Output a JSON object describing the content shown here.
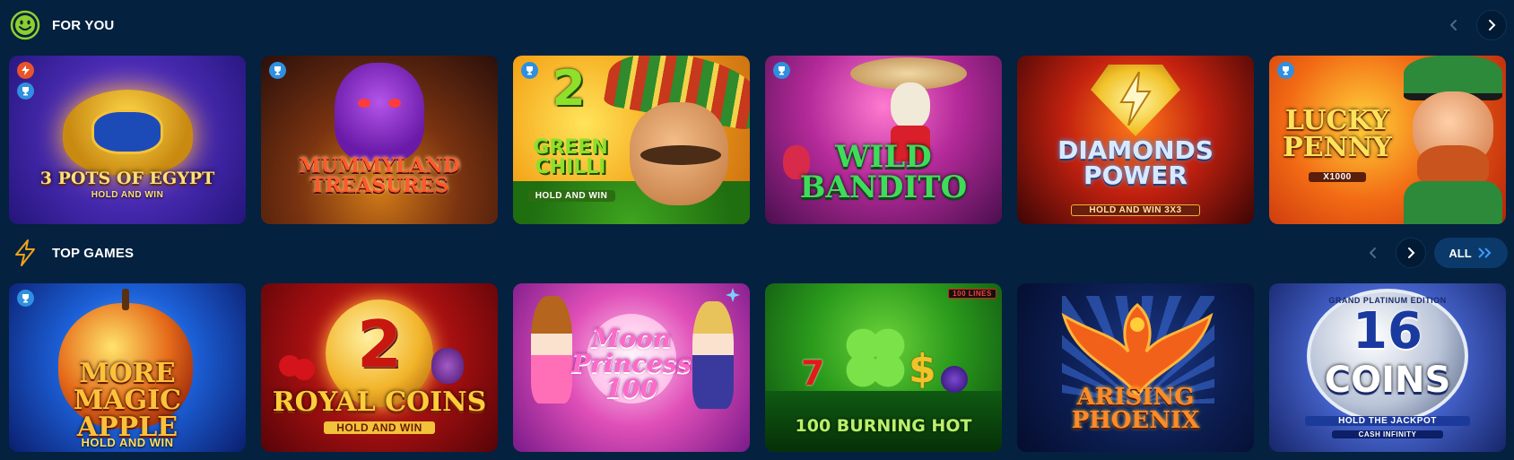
{
  "sections": [
    {
      "title": "FOR YOU",
      "icon": "smiley-icon",
      "games": [
        {
          "title": "3 POTS of EGYPT",
          "subtitle": "HOLD AND WIN",
          "badges": [
            "bolt",
            "trophy"
          ]
        },
        {
          "title": "MUMMYLAND TREASURES",
          "subtitle": "",
          "badges": [
            "trophy"
          ]
        },
        {
          "title_line1": "2",
          "title": "GREEN CHILLI",
          "subtitle": "HOLD AND WIN",
          "badges": [
            "trophy"
          ]
        },
        {
          "title": "WILD BANDITO",
          "subtitle": "",
          "badges": [
            "trophy"
          ]
        },
        {
          "title": "DIAMONDS POWER",
          "subtitle": "HOLD AND WIN 3X3",
          "badges": []
        },
        {
          "title": "LUCKY PENNY",
          "subtitle": "X1000",
          "badges": [
            "trophy"
          ]
        }
      ]
    },
    {
      "title": "TOP GAMES",
      "icon": "lightning-icon",
      "all_label": "ALL",
      "games": [
        {
          "title": "More MAGIC APPLE",
          "subtitle": "HOLD AND WIN",
          "badges": [
            "trophy"
          ]
        },
        {
          "title_line1": "2",
          "title": "ROYAL COINS",
          "subtitle": "HOLD AND WIN",
          "badges": []
        },
        {
          "title": "Moon Princess 100",
          "subtitle": "",
          "badges": []
        },
        {
          "title": "100 BURNING HOT",
          "subtitle": "100 LINES",
          "badges": []
        },
        {
          "title": "ARISING PHOENIX",
          "subtitle": "",
          "badges": []
        },
        {
          "title_line1": "16",
          "title": "COINS",
          "subtitle": "HOLD THE JACKPOT",
          "edition": "GRAND PLATINUM EDITION",
          "extra": "CASH INFINITY",
          "badges": []
        }
      ]
    }
  ],
  "colors": {
    "background": "#04213f",
    "accent_green": "#8ecf2f",
    "accent_blue": "#2f8fe0",
    "accent_orange": "#f2a31b"
  }
}
